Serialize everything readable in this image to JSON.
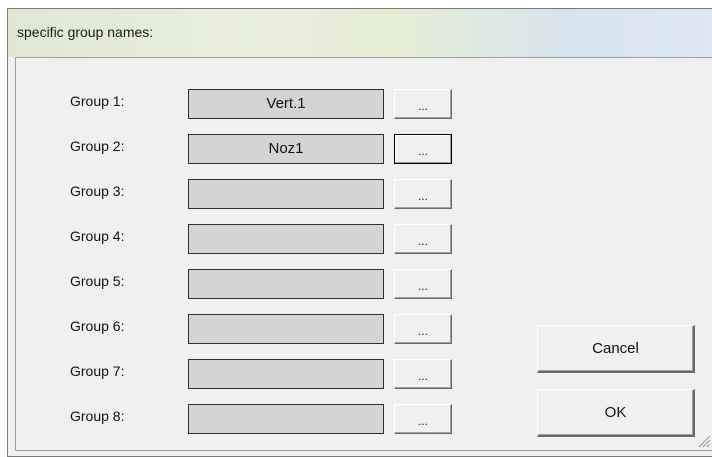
{
  "window": {
    "title": "specific group names:"
  },
  "groups": [
    {
      "label": "Group 1:",
      "value": "Vert.1",
      "browse": "..."
    },
    {
      "label": "Group 2:",
      "value": "Noz1",
      "browse": "..."
    },
    {
      "label": "Group 3:",
      "value": "",
      "browse": "..."
    },
    {
      "label": "Group 4:",
      "value": "",
      "browse": "..."
    },
    {
      "label": "Group 5:",
      "value": "",
      "browse": "..."
    },
    {
      "label": "Group 6:",
      "value": "",
      "browse": "..."
    },
    {
      "label": "Group 7:",
      "value": "",
      "browse": "..."
    },
    {
      "label": "Group 8:",
      "value": "",
      "browse": "..."
    }
  ],
  "buttons": {
    "cancel": "Cancel",
    "ok": "OK"
  },
  "focused_browse_index": 1,
  "icons": {
    "resize_grip": "resize-grip-icon"
  }
}
